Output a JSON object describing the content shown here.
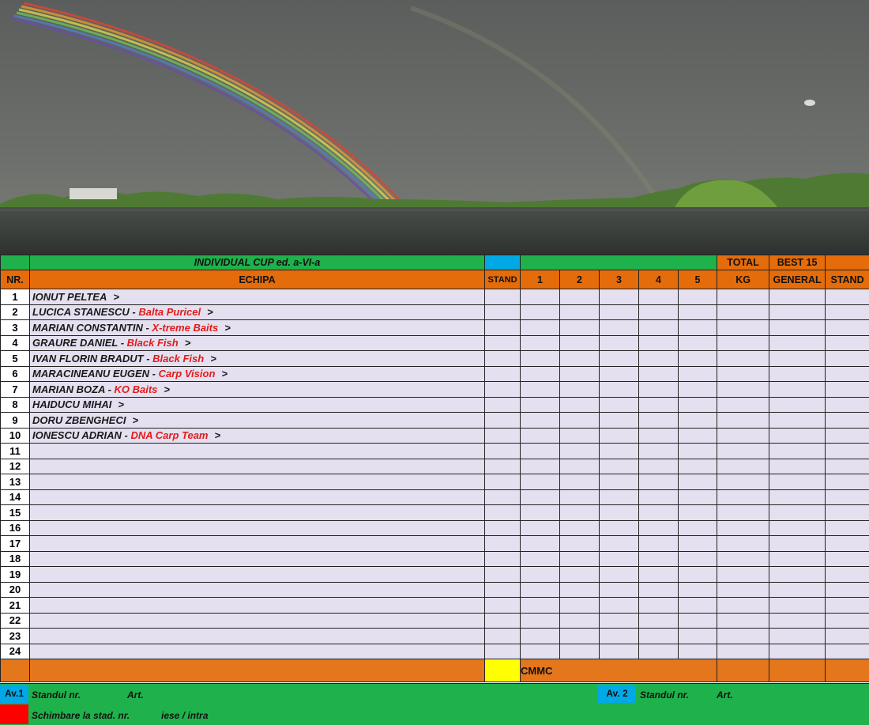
{
  "header": {
    "title": "INDIVIDUAL CUP ed. a-VI-a",
    "total": "TOTAL",
    "best": "BEST 15",
    "nr": "NR.",
    "echipa": "ECHIPA",
    "stand": "STAND",
    "rounds": [
      "1",
      "2",
      "3",
      "4",
      "5"
    ],
    "kg": "KG",
    "general": "GENERAL",
    "stand_final": "STAND"
  },
  "rows": [
    {
      "nr": "1",
      "name": "IONUT PELTEA",
      "sep": "",
      "team": "",
      "arrow": ">"
    },
    {
      "nr": "2",
      "name": "LUCICA STANESCU",
      "sep": " - ",
      "team": "Balta Puricel",
      "arrow": ">"
    },
    {
      "nr": "3",
      "name": "MARIAN CONSTANTIN",
      "sep": " - ",
      "team": "X-treme Baits",
      "arrow": ">"
    },
    {
      "nr": "4",
      "name": "GRAURE DANIEL",
      "sep": " - ",
      "team": "Black Fish",
      "arrow": ">"
    },
    {
      "nr": "5",
      "name": "IVAN FLORIN BRADUT",
      "sep": "  - ",
      "team": "Black Fish",
      "arrow": ">"
    },
    {
      "nr": "6",
      "name": "MARACINEANU EUGEN",
      "sep": " - ",
      "team": "Carp Vision",
      "arrow": ">"
    },
    {
      "nr": "7",
      "name": "MARIAN BOZA",
      "sep": " - ",
      "team": "KO Baits",
      "arrow": ">"
    },
    {
      "nr": "8",
      "name": "HAIDUCU MIHAI",
      "sep": "",
      "team": "",
      "arrow": ">"
    },
    {
      "nr": "9",
      "name": "DORU ZBENGHECI",
      "sep": "",
      "team": "",
      "arrow": ">"
    },
    {
      "nr": "10",
      "name": "IONESCU ADRIAN",
      "sep": " - ",
      "team": "DNA Carp Team",
      "arrow": ">"
    },
    {
      "nr": "11",
      "name": "",
      "sep": "",
      "team": "",
      "arrow": ""
    },
    {
      "nr": "12",
      "name": "",
      "sep": "",
      "team": "",
      "arrow": ""
    },
    {
      "nr": "13",
      "name": "",
      "sep": "",
      "team": "",
      "arrow": ""
    },
    {
      "nr": "14",
      "name": "",
      "sep": "",
      "team": "",
      "arrow": ""
    },
    {
      "nr": "15",
      "name": "",
      "sep": "",
      "team": "",
      "arrow": ""
    },
    {
      "nr": "16",
      "name": "",
      "sep": "",
      "team": "",
      "arrow": ""
    },
    {
      "nr": "17",
      "name": "",
      "sep": "",
      "team": "",
      "arrow": ""
    },
    {
      "nr": "18",
      "name": "",
      "sep": "",
      "team": "",
      "arrow": ""
    },
    {
      "nr": "19",
      "name": "",
      "sep": "",
      "team": "",
      "arrow": ""
    },
    {
      "nr": "20",
      "name": "",
      "sep": "",
      "team": "",
      "arrow": ""
    },
    {
      "nr": "21",
      "name": "",
      "sep": "",
      "team": "",
      "arrow": ""
    },
    {
      "nr": "22",
      "name": "",
      "sep": "",
      "team": "",
      "arrow": ""
    },
    {
      "nr": "23",
      "name": "",
      "sep": "",
      "team": "",
      "arrow": ""
    },
    {
      "nr": "24",
      "name": "",
      "sep": "",
      "team": "",
      "arrow": ""
    }
  ],
  "footer": {
    "cmmc": "CMMC"
  },
  "legend": {
    "av1": "Av.1",
    "standul1": "Standul nr.",
    "art1": "Art.",
    "av2": "Av. 2",
    "standul2": "Standul  nr.",
    "art2": "Art.",
    "schimbare": "Schimbare la stad.  nr.",
    "iese": "iese / intra"
  },
  "colors": {
    "header_green": "#1fb14c",
    "header_orange": "#e46c0a",
    "stand_blue": "#00a9e6",
    "row_fill": "#e4e0ef",
    "team_red": "#e21b1b",
    "marker_yellow": "#ffff00",
    "marker_red": "#ff0000"
  }
}
